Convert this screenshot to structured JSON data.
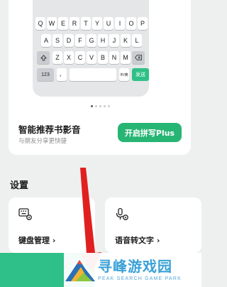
{
  "keyboard_preview": {
    "row1": [
      "Q",
      "W",
      "E",
      "R",
      "T",
      "Y",
      "U",
      "I",
      "O",
      "P"
    ],
    "row2": [
      "A",
      "S",
      "D",
      "F",
      "G",
      "H",
      "J",
      "K",
      "L"
    ],
    "row3": [
      "Z",
      "X",
      "C",
      "V",
      "B",
      "N",
      "M"
    ],
    "num_key": "123",
    "comma_key": "，",
    "lang_key": "中/英",
    "send_key": "发送",
    "page_dots": 5,
    "active_dot": 0
  },
  "promo": {
    "title": "智能推荐书影音",
    "subtitle": "与朋友分享更快捷",
    "button_label": "开启拼写Plus"
  },
  "settings": {
    "section_title": "设置",
    "tiles": [
      {
        "label": "键盘管理",
        "icon": "keyboard-gear-icon"
      },
      {
        "label": "语音转文字",
        "icon": "microphone-gear-icon"
      }
    ]
  },
  "watermark": {
    "title": "寻峰游戏园",
    "subtitle": "PEAK SEARCH GAME PARK"
  },
  "colors": {
    "accent_green": "#27b574",
    "arrow_red": "#e02020",
    "watermark_blue": "#3aa1d6"
  }
}
